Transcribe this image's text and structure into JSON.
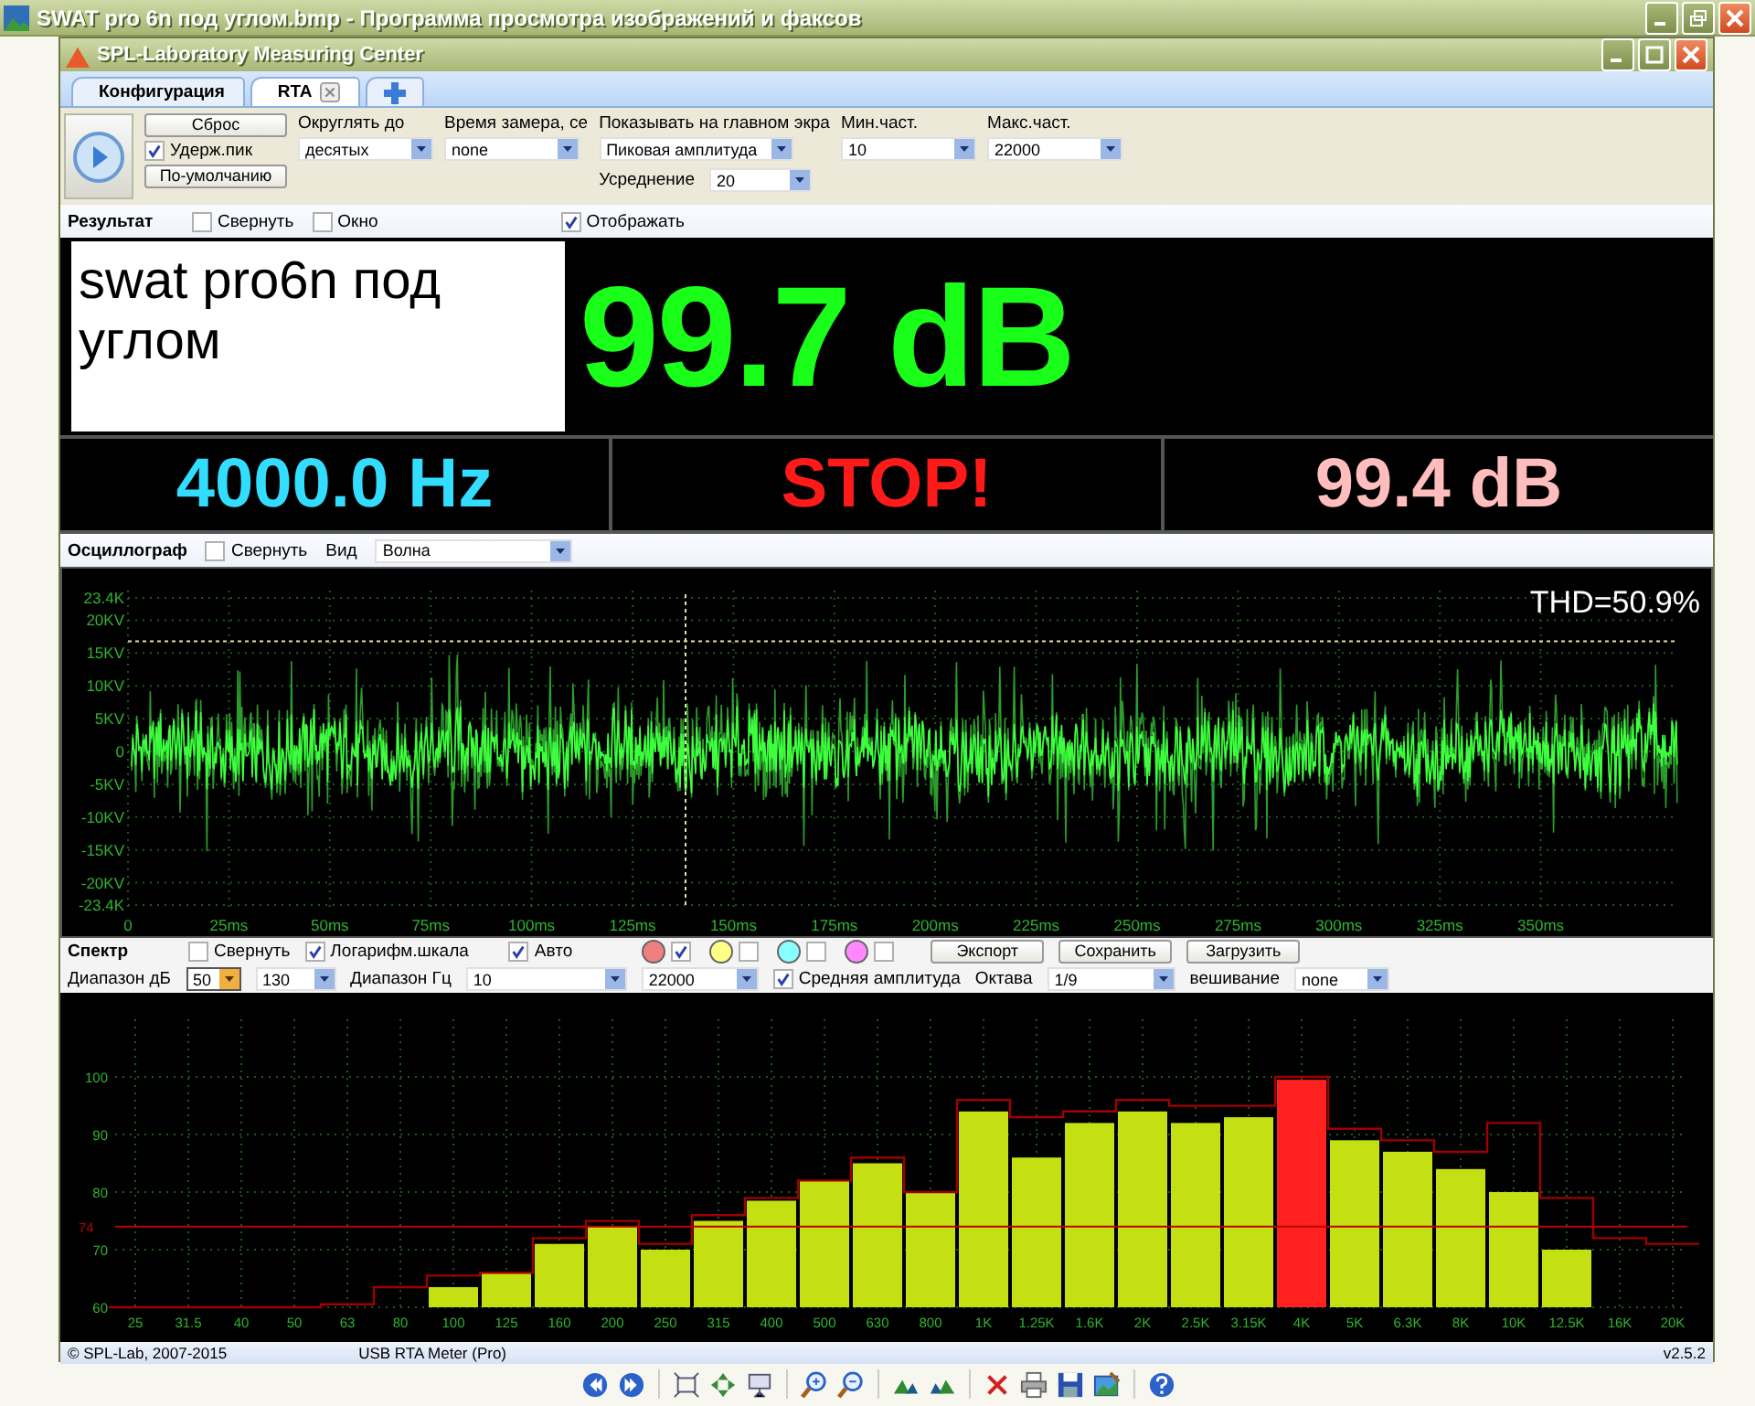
{
  "window": {
    "title": "SWAT pro 6n под углом.bmp - Программа просмотра изображений и факсов"
  },
  "app": {
    "title": "SPL-Laboratory Measuring Center"
  },
  "tabs": [
    {
      "kind": "text",
      "label": "Конфигурация",
      "selected": false,
      "closable": false
    },
    {
      "kind": "text",
      "label": "RTA",
      "selected": true,
      "closable": true
    },
    {
      "kind": "add",
      "selected": false,
      "closable": false
    }
  ],
  "config": {
    "reset_button": "Сброс",
    "hold_peak": {
      "label": "Удерж.пик",
      "checked": true
    },
    "default_button": "По-умолчанию",
    "columns": [
      {
        "fields": [
          {
            "kind": "stacked",
            "label": "Округлять до",
            "value": "десятых"
          }
        ]
      },
      {
        "fields": [
          {
            "kind": "stacked",
            "label": "Время замера, се",
            "value": "none"
          }
        ]
      },
      {
        "fields": [
          {
            "kind": "stacked",
            "label": "Показывать на главном экра",
            "value": "Пиковая амплитуда"
          },
          {
            "kind": "inline",
            "label": "Усреднение",
            "value": "20"
          }
        ]
      },
      {
        "fields": [
          {
            "kind": "stacked",
            "label": "Мин.част.",
            "value": "10"
          }
        ]
      },
      {
        "fields": [
          {
            "kind": "stacked",
            "label": "Макс.част.",
            "value": "22000"
          }
        ]
      }
    ]
  },
  "result": {
    "title": "Результат",
    "checkboxes": [
      {
        "label": "Свернуть",
        "checked": false
      },
      {
        "label": "Окно",
        "checked": false
      },
      {
        "label": "Отображать",
        "checked": true
      }
    ],
    "note": "swat pro6n под углом",
    "value": "99.7 dB",
    "readouts": [
      {
        "text": "4000.0 Hz",
        "color": "#33ddff"
      },
      {
        "text": "STOP!",
        "color": "#ff1a1a"
      },
      {
        "text": "99.4 dB",
        "color": "#ffbdbd"
      }
    ]
  },
  "oscilloscope": {
    "title": "Осциллограф",
    "collapse": {
      "label": "Свернуть",
      "checked": false
    },
    "view_label": "Вид",
    "view_value": "Волна",
    "y_ticks": [
      "23.4K",
      "20KV",
      "15KV",
      "10KV",
      "5KV",
      "0",
      "-5KV",
      "-10KV",
      "-15KV",
      "-20KV",
      "-23.4K"
    ],
    "x_ticks": [
      "0",
      "25ms",
      "50ms",
      "75ms",
      "100ms",
      "125ms",
      "150ms",
      "175ms",
      "200ms",
      "225ms",
      "250ms",
      "275ms",
      "300ms",
      "325ms",
      "350ms"
    ],
    "thd": "THD=50.9%"
  },
  "spectrum": {
    "title": "Спектр",
    "checkboxes": [
      {
        "label": "Свернуть",
        "checked": false
      },
      {
        "label": "Логарифм.шкала",
        "checked": true
      },
      {
        "label": "Авто",
        "checked": true
      }
    ],
    "traces": [
      {
        "color": "#f08080",
        "checked": true
      },
      {
        "color": "#ffff88",
        "checked": false
      },
      {
        "color": "#88ffff",
        "checked": false
      },
      {
        "color": "#ff88ff",
        "checked": false
      }
    ],
    "buttons": [
      "Экспорт",
      "Сохранить",
      "Загрузить"
    ],
    "options": [
      {
        "kind": "label",
        "text": "Диапазон дБ"
      },
      {
        "kind": "spin",
        "value": "50"
      },
      {
        "kind": "select",
        "value": "130"
      },
      {
        "kind": "label",
        "text": "Диапазон Гц"
      },
      {
        "kind": "select",
        "value": "10"
      },
      {
        "kind": "select",
        "value": "22000"
      },
      {
        "kind": "checkbox",
        "label": "Средняя амплитуда",
        "checked": true
      },
      {
        "kind": "label",
        "text": "Октава"
      },
      {
        "kind": "select",
        "value": "1/9"
      },
      {
        "kind": "label",
        "text": "вешивание"
      },
      {
        "kind": "select",
        "value": "none"
      }
    ],
    "chart_data": {
      "type": "bar",
      "categories": [
        "25",
        "31.5",
        "40",
        "50",
        "63",
        "80",
        "100",
        "125",
        "160",
        "200",
        "250",
        "315",
        "400",
        "500",
        "630",
        "800",
        "1K",
        "1.25K",
        "1.6K",
        "2K",
        "2.5K",
        "3.15K",
        "4K",
        "5K",
        "6.3K",
        "8K",
        "10K",
        "12.5K",
        "16K",
        "20K"
      ],
      "series": [
        {
          "color": "#c4e012",
          "values": [
            null,
            null,
            null,
            null,
            null,
            null,
            63.5,
            66,
            71,
            74,
            70,
            75,
            78.5,
            82,
            85,
            80,
            94,
            86,
            92,
            94,
            92,
            93,
            null,
            89,
            87,
            84,
            80,
            70,
            null,
            null
          ]
        },
        {
          "color": "#ff2020",
          "values": [
            null,
            null,
            null,
            null,
            null,
            null,
            null,
            null,
            null,
            null,
            null,
            null,
            null,
            null,
            null,
            null,
            null,
            null,
            null,
            null,
            null,
            null,
            99.5,
            null,
            null,
            null,
            null,
            null,
            null,
            null
          ]
        }
      ],
      "ylim": [
        60,
        110
      ],
      "yticks": [
        60,
        70,
        80,
        90,
        100
      ],
      "grid": true,
      "ref_lines": [
        {
          "axis": "y",
          "value": 74,
          "label": "74",
          "color": "#c00000"
        }
      ]
    }
  },
  "status_bar": [
    "© SPL-Lab, 2007-2015",
    "USB RTA Meter (Pro)",
    "v2.5.2"
  ]
}
